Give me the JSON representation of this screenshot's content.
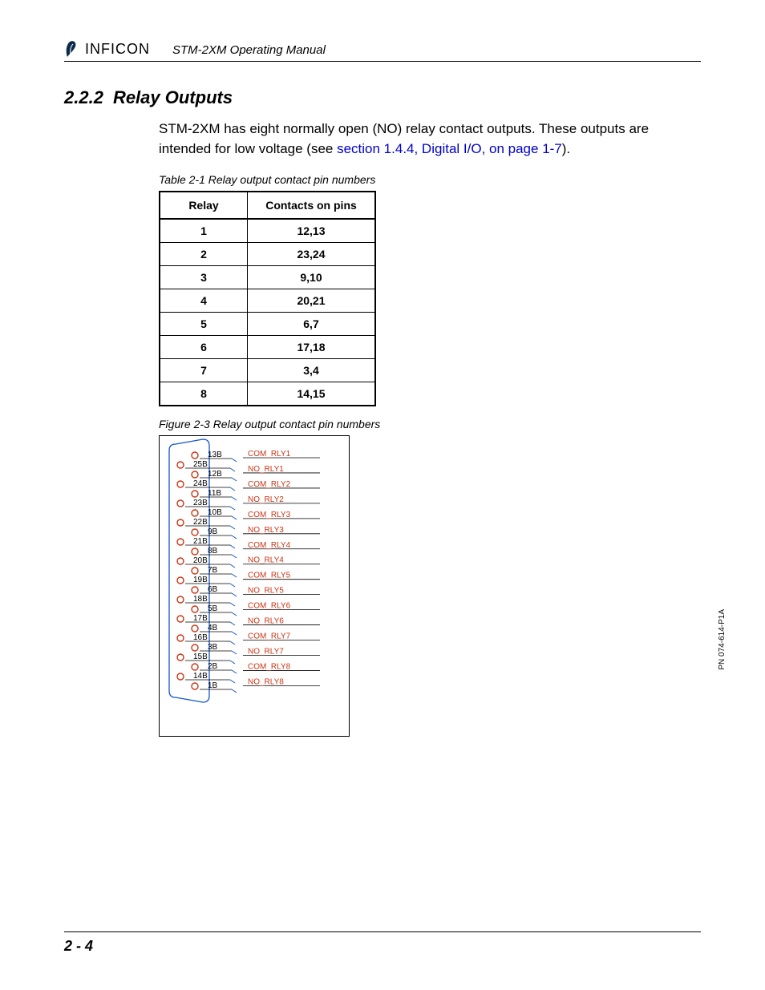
{
  "header": {
    "logo_text": "INFICON",
    "manual_title": "STM-2XM Operating Manual"
  },
  "section": {
    "number": "2.2.2",
    "title": "Relay Outputs"
  },
  "paragraph": {
    "pre": "STM-2XM has eight normally open (NO) relay contact outputs. These outputs are intended for low voltage (see ",
    "link": "section 1.4.4, Digital I/O, on page 1-7",
    "post": ")."
  },
  "table_caption": "Table 2-1  Relay output contact pin numbers",
  "table": {
    "headers": {
      "relay": "Relay",
      "pins": "Contacts on pins"
    },
    "rows": [
      {
        "relay": "1",
        "pins": "12,13"
      },
      {
        "relay": "2",
        "pins": "23,24"
      },
      {
        "relay": "3",
        "pins": "9,10"
      },
      {
        "relay": "4",
        "pins": "20,21"
      },
      {
        "relay": "5",
        "pins": "6,7"
      },
      {
        "relay": "6",
        "pins": "17,18"
      },
      {
        "relay": "7",
        "pins": "3,4"
      },
      {
        "relay": "8",
        "pins": "14,15"
      }
    ]
  },
  "figure_caption": "Figure 2-3  Relay output contact pin numbers",
  "connector": {
    "rows": [
      {
        "right": "13B",
        "left": "25B",
        "label": "COM_RLY1"
      },
      {
        "right": "12B",
        "left": "24B",
        "label": "NO_RLY1"
      },
      {
        "right": "11B",
        "left": "23B",
        "label": "COM_RLY2"
      },
      {
        "right": "10B",
        "left": "22B",
        "label": "NO_RLY2"
      },
      {
        "right": "9B",
        "left": "21B",
        "label": "COM_RLY3"
      },
      {
        "right": "8B",
        "left": "20B",
        "label": "NO_RLY3"
      },
      {
        "right": "7B",
        "left": "19B",
        "label": "COM_RLY4"
      },
      {
        "right": "6B",
        "left": "18B",
        "label": "NO_RLY4"
      },
      {
        "right": "5B",
        "left": "17B",
        "label": "COM_RLY5"
      },
      {
        "right": "4B",
        "left": "16B",
        "label": "NO_RLY5"
      },
      {
        "right": "3B",
        "left": "15B",
        "label": "COM_RLY6"
      },
      {
        "right": "2B",
        "left": "14B",
        "label": "NO_RLY6"
      },
      {
        "right": "",
        "left": "1B",
        "label": "COM_RLY7"
      },
      {
        "right": "",
        "left": "",
        "label": "NO_RLY7"
      },
      {
        "right": "",
        "left": "",
        "label": "COM_RLY8"
      },
      {
        "right": "",
        "left": "",
        "label": "NO_RLY8"
      }
    ],
    "right_pins": [
      "13B",
      "12B",
      "11B",
      "10B",
      "9B",
      "8B",
      "7B",
      "6B",
      "5B",
      "4B",
      "3B",
      "2B"
    ],
    "left_pins": [
      "25B",
      "24B",
      "23B",
      "22B",
      "21B",
      "20B",
      "19B",
      "18B",
      "17B",
      "16B",
      "15B",
      "14B",
      "1B"
    ],
    "labels_all": [
      "COM_RLY1",
      "NO_RLY1",
      "COM_RLY2",
      "NO_RLY2",
      "COM_RLY3",
      "NO_RLY3",
      "COM_RLY4",
      "NO_RLY4",
      "COM_RLY5",
      "NO_RLY5",
      "COM_RLY6",
      "NO_RLY6",
      "COM_RLY7",
      "NO_RLY7",
      "COM_RLY8",
      "NO_RLY8"
    ]
  },
  "side_pn": "PN 074-614-P1A",
  "page_number": "2 - 4"
}
